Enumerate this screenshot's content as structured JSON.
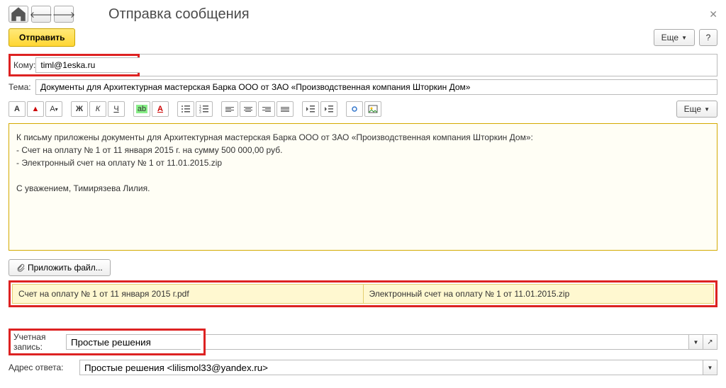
{
  "header": {
    "title": "Отправка сообщения"
  },
  "actions": {
    "send_label": "Отправить",
    "more_label": "Еще",
    "help_label": "?",
    "attach_label": "Приложить файл..."
  },
  "fields": {
    "to_label": "Кому:",
    "to_value": "timl@1eska.ru",
    "subject_label": "Тема:",
    "subject_value": "Документы для Архитектурная мастерская Барка ООО от ЗАО «Производственная компания Шторкин Дом»",
    "account_label": "Учетная запись:",
    "account_value": "Простые решения",
    "reply_label": "Адрес ответа:",
    "reply_value": "Простые решения <lilismol33@yandex.ru>"
  },
  "body": {
    "line1": "К письму приложены документы для Архитектурная мастерская Барка ООО от ЗАО «Производственная компания Шторкин Дом»:",
    "line2": "- Счет на оплату № 1 от 11 января 2015 г. на сумму 500 000,00 руб.",
    "line3": "- Электронный счет на оплату № 1 от 11.01.2015.zip",
    "line4": "С уважением, Тимирязева Лилия."
  },
  "attachments": [
    "Счет на оплату № 1 от 11 января 2015 г.pdf",
    "Электронный счет на оплату № 1 от 11.01.2015.zip"
  ],
  "toolbar_more": "Еще"
}
